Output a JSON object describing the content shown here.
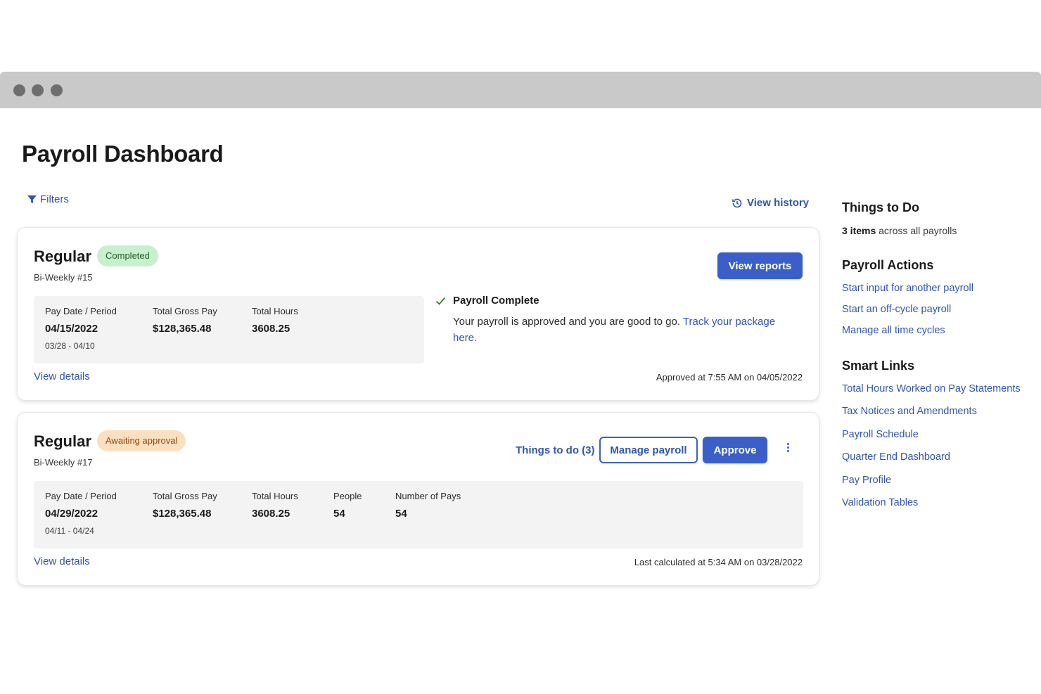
{
  "page": {
    "title": "Payroll Dashboard"
  },
  "toolbar": {
    "filters_label": "Filters",
    "history_label": "View history"
  },
  "colors": {
    "accent": "#3a5fc8",
    "completed_badge": "#c7f0cc",
    "awaiting_badge": "#fbe0c0"
  },
  "payrolls": [
    {
      "title": "Regular",
      "status": "Completed",
      "schedule": "Bi-Weekly #15",
      "action_label": "View reports",
      "stats": [
        {
          "label": "Pay Date / Period",
          "value": "04/15/2022",
          "sub": "03/28 - 04/10"
        },
        {
          "label": "Total Gross Pay",
          "value": "$128,365.48"
        },
        {
          "label": "Total Hours",
          "value": "3608.25"
        }
      ],
      "message": {
        "title": "Payroll Complete",
        "text": "Your payroll is approved and you are good to go. ",
        "link": "Track your package here."
      },
      "details_label": "View details",
      "meta": "Approved at 7:55 AM on 04/05/2022"
    },
    {
      "title": "Regular",
      "status": "Awaiting approval",
      "schedule": "Bi-Weekly #17",
      "things_label": "Things to do (3)",
      "manage_label": "Manage payroll",
      "approve_label": "Approve",
      "stats": [
        {
          "label": "Pay Date / Period",
          "value": "04/29/2022",
          "sub": "04/11 - 04/24"
        },
        {
          "label": "Total Gross Pay",
          "value": "$128,365.48"
        },
        {
          "label": "Total Hours",
          "value": "3608.25"
        },
        {
          "label": "People",
          "value": "54"
        },
        {
          "label": "Number of Pays",
          "value": "54"
        }
      ],
      "details_label": "View details",
      "meta": "Last calculated at 5:34 AM on 03/28/2022"
    }
  ],
  "sidebar": {
    "todo_title": "Things to Do",
    "todo_count": "3 items",
    "todo_suffix": " across all payrolls",
    "actions_title": "Payroll Actions",
    "actions": [
      "Start input for another payroll",
      "Start an off-cycle payroll",
      "Manage all time cycles"
    ],
    "links_title": "Smart Links",
    "links": [
      "Total Hours Worked on Pay Statements",
      "Tax Notices and Amendments",
      "Payroll Schedule",
      "Quarter End Dashboard",
      "Pay Profile",
      "Validation Tables"
    ]
  }
}
